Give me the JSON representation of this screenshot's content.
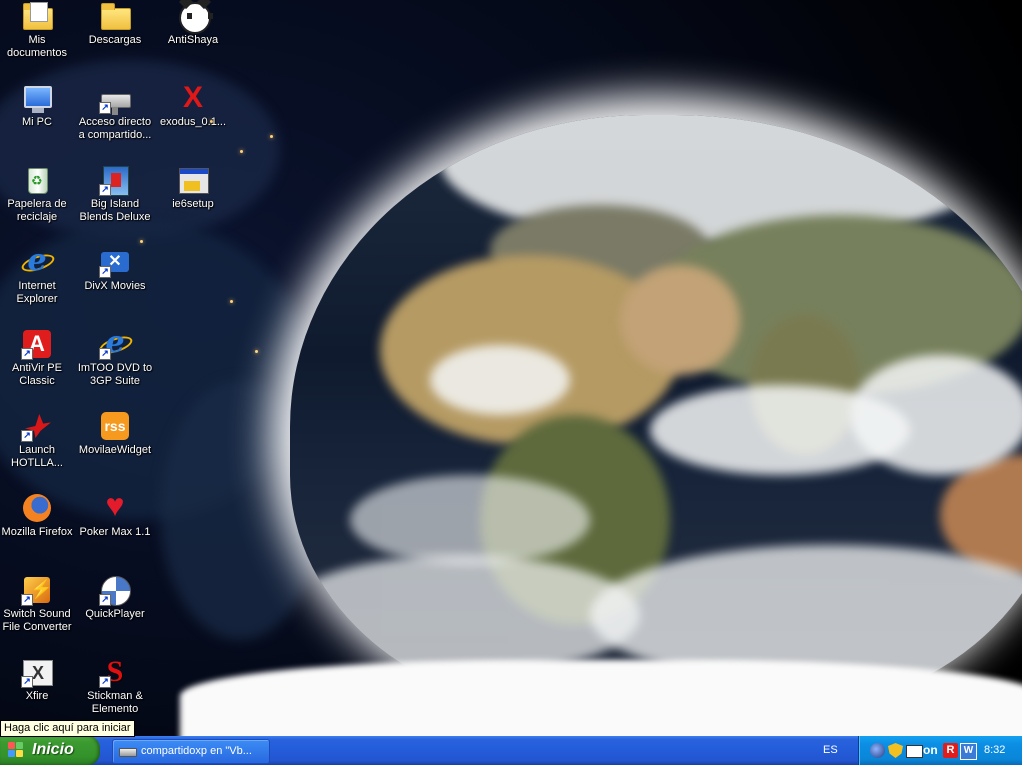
{
  "desktop": {
    "icons": [
      {
        "label": "Mis documentos",
        "icon": "my-documents-icon"
      },
      {
        "label": "Mi PC",
        "icon": "my-computer-icon"
      },
      {
        "label": "Papelera de reciclaje",
        "icon": "recycle-bin-icon"
      },
      {
        "label": "Internet Explorer",
        "icon": "internet-explorer-icon"
      },
      {
        "label": "AntiVir PE Classic",
        "icon": "avira-icon"
      },
      {
        "label": "Launch HOTLLA...",
        "icon": "hotline-icon"
      },
      {
        "label": "Mozilla Firefox",
        "icon": "firefox-icon"
      },
      {
        "label": "Switch Sound File Converter",
        "icon": "switch-sound-icon"
      },
      {
        "label": "Xfire",
        "icon": "xfire-icon"
      },
      {
        "label": "Descargas",
        "icon": "folder-icon"
      },
      {
        "label": "Acceso directo a compartido...",
        "icon": "network-drive-icon"
      },
      {
        "label": "Big Island Blends Deluxe",
        "icon": "big-island-icon"
      },
      {
        "label": "DivX Movies",
        "icon": "divx-icon"
      },
      {
        "label": "ImTOO DVD to 3GP Suite",
        "icon": "imtoo-icon"
      },
      {
        "label": "MovilaeWidget",
        "icon": "rss-icon"
      },
      {
        "label": "Poker Max 1.1",
        "icon": "heart-icon"
      },
      {
        "label": "QuickPlayer",
        "icon": "quickplayer-icon"
      },
      {
        "label": "Stickman & Elemento",
        "icon": "stickman-icon"
      },
      {
        "label": "AntiShaya",
        "icon": "cat-icon"
      },
      {
        "label": "exodus_0.1...",
        "icon": "exodus-icon"
      },
      {
        "label": "ie6setup",
        "icon": "setup-icon"
      }
    ]
  },
  "tooltip": {
    "text": "Haga clic aquí para iniciar"
  },
  "taskbar": {
    "start_label": "Inicio",
    "task_label": "compartidoxp en \"Vb...",
    "language": "ES",
    "tray_on_label": "on",
    "tray_avira_label": "R",
    "tray_w_label": "W",
    "clock": "8:32",
    "colors": {
      "taskbar": "#245edb",
      "start": "#3c9a31",
      "tray": "#0b8ee4"
    }
  }
}
